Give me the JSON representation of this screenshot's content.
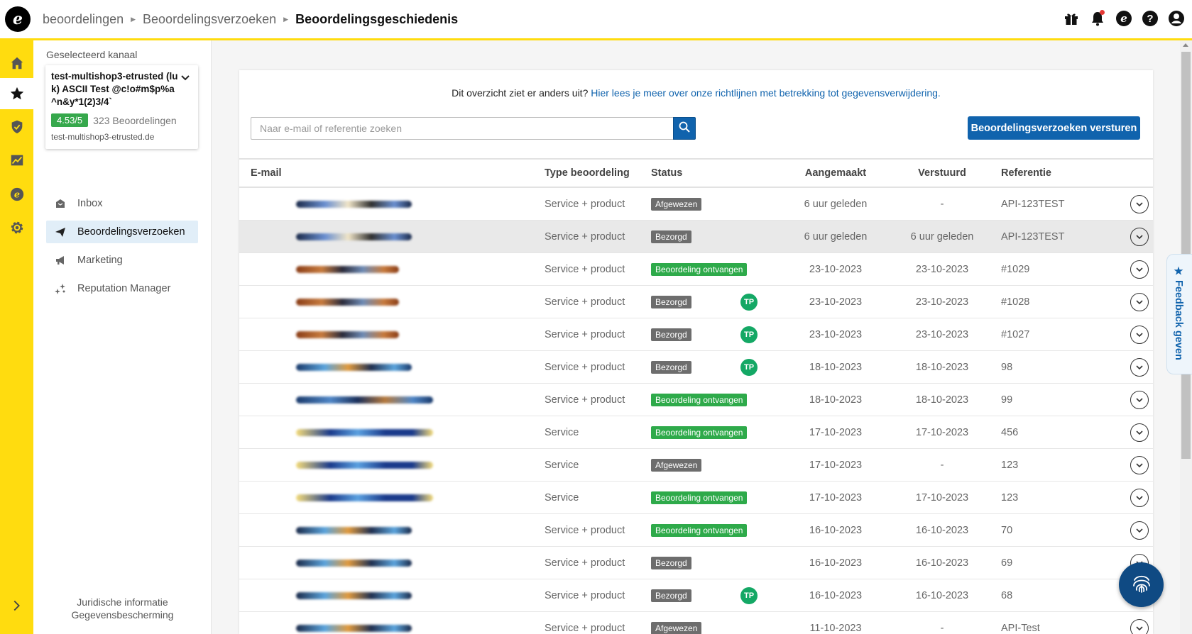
{
  "breadcrumbs": [
    "beoordelingen",
    "Beoordelingsverzoeken",
    "Beoordelingsgeschiedenis"
  ],
  "logo_letter": "e",
  "top_icons": [
    "gift-icon",
    "bell-icon",
    "etrusted-icon",
    "help-icon",
    "account-icon"
  ],
  "rail": [
    "home-icon",
    "star-icon",
    "shield-check-icon",
    "chart-icon",
    "etrusted-icon",
    "gear-icon"
  ],
  "sidebar": {
    "selected_label": "Geselecteerd kanaal",
    "channel": {
      "name": "test-multishop3-etrusted (luk) ASCII Test @c!o#m$p%a^n&y*1(2)3/4`",
      "rating": "4.53/5",
      "count": "323 Beoordelingen",
      "url": "test-multishop3-etrusted.de"
    },
    "items": [
      {
        "label": "Inbox",
        "icon": "inbox-icon"
      },
      {
        "label": "Beoordelingsverzoeken",
        "icon": "paper-plane-icon"
      },
      {
        "label": "Marketing",
        "icon": "megaphone-icon"
      },
      {
        "label": "Reputation Manager",
        "icon": "sparkles-icon"
      }
    ],
    "footer": [
      "Juridische informatie",
      "Gegevensbescherming"
    ]
  },
  "main": {
    "notice_text": "Dit overzicht ziet er anders uit?",
    "notice_link": "Hier lees je meer over onze richtlijnen met betrekking tot gegevensverwijdering.",
    "search_placeholder": "Naar e-mail of referentie zoeken",
    "send_button": "Beoordelingsverzoeken versturen",
    "columns": [
      "E-mail",
      "Type beoordeling",
      "Status",
      "Aangemaakt",
      "Verstuurd",
      "Referentie"
    ],
    "rows": [
      {
        "type": "Service + product",
        "status": "Afgewezen",
        "status_color": "grey",
        "tp": false,
        "created": "6 uur geleden",
        "sent": "-",
        "ref": "API-123TEST"
      },
      {
        "type": "Service + product",
        "status": "Bezorgd",
        "status_color": "grey",
        "tp": false,
        "created": "6 uur geleden",
        "sent": "6 uur geleden",
        "ref": "API-123TEST"
      },
      {
        "type": "Service + product",
        "status": "Beoordeling ontvangen",
        "status_color": "green",
        "tp": false,
        "created": "23-10-2023",
        "sent": "23-10-2023",
        "ref": "#1029"
      },
      {
        "type": "Service + product",
        "status": "Bezorgd",
        "status_color": "grey",
        "tp": true,
        "created": "23-10-2023",
        "sent": "23-10-2023",
        "ref": "#1028"
      },
      {
        "type": "Service + product",
        "status": "Bezorgd",
        "status_color": "grey",
        "tp": true,
        "created": "23-10-2023",
        "sent": "23-10-2023",
        "ref": "#1027"
      },
      {
        "type": "Service + product",
        "status": "Bezorgd",
        "status_color": "grey",
        "tp": true,
        "created": "18-10-2023",
        "sent": "18-10-2023",
        "ref": "98"
      },
      {
        "type": "Service + product",
        "status": "Beoordeling ontvangen",
        "status_color": "green",
        "tp": false,
        "created": "18-10-2023",
        "sent": "18-10-2023",
        "ref": "99"
      },
      {
        "type": "Service",
        "status": "Beoordeling ontvangen",
        "status_color": "green",
        "tp": false,
        "created": "17-10-2023",
        "sent": "17-10-2023",
        "ref": "456"
      },
      {
        "type": "Service",
        "status": "Afgewezen",
        "status_color": "grey",
        "tp": false,
        "created": "17-10-2023",
        "sent": "-",
        "ref": "123"
      },
      {
        "type": "Service",
        "status": "Beoordeling ontvangen",
        "status_color": "green",
        "tp": false,
        "created": "17-10-2023",
        "sent": "17-10-2023",
        "ref": "123"
      },
      {
        "type": "Service + product",
        "status": "Beoordeling ontvangen",
        "status_color": "green",
        "tp": false,
        "created": "16-10-2023",
        "sent": "16-10-2023",
        "ref": "70"
      },
      {
        "type": "Service + product",
        "status": "Bezorgd",
        "status_color": "grey",
        "tp": false,
        "created": "16-10-2023",
        "sent": "16-10-2023",
        "ref": "69"
      },
      {
        "type": "Service + product",
        "status": "Bezorgd",
        "status_color": "grey",
        "tp": true,
        "created": "16-10-2023",
        "sent": "16-10-2023",
        "ref": "68"
      },
      {
        "type": "Service + product",
        "status": "Afgewezen",
        "status_color": "grey",
        "tp": false,
        "created": "11-10-2023",
        "sent": "-",
        "ref": "API-Test"
      }
    ],
    "tp_label": "TP"
  },
  "feedback_tab": "★ Feedback geven",
  "colors": {
    "brand_yellow": "#ffdc0f",
    "primary_blue": "#1063ad",
    "green": "#2eaa4a",
    "grey_badge": "#6d6d6d"
  }
}
